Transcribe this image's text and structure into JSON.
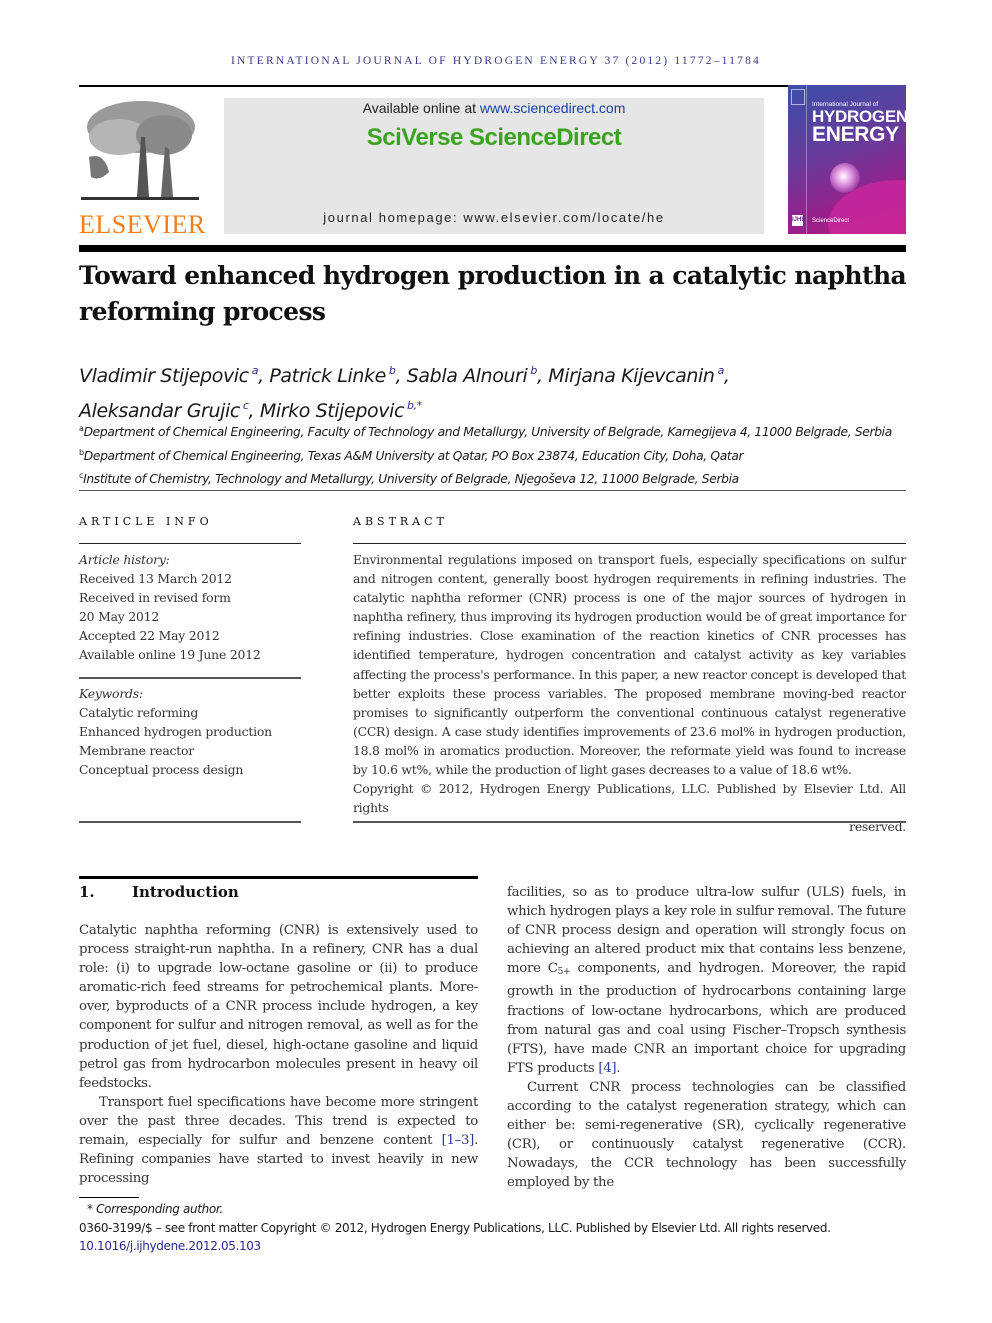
{
  "running_head": "INTERNATIONAL JOURNAL OF HYDROGEN ENERGY 37 (2012) 11772–11784",
  "masthead": {
    "publisher_logo_text": "ELSEVIER",
    "available_online_prefix": "Available online at ",
    "available_online_link": "www.sciencedirect.com",
    "brand": "SciVerse ScienceDirect",
    "homepage": "journal homepage: www.elsevier.com/locate/he",
    "cover": {
      "small_title": "International Journal of",
      "big_title_1": "HYDROGEN",
      "big_title_2": "ENERGY",
      "badge": "IJHE",
      "footer": "ScienceDirect"
    },
    "colors": {
      "elsevier_orange": "#f07f1a",
      "sciencedirect_green": "#3aa41e",
      "link_blue": "#1a3fa8",
      "running_head": "#3a3a86"
    }
  },
  "article": {
    "title": "Toward enhanced hydrogen production in a catalytic naphtha reforming process",
    "authors": [
      {
        "name": "Vladimir Stijepovic",
        "aff": "a",
        "sep": ", "
      },
      {
        "name": "Patrick Linke",
        "aff": "b",
        "sep": ", "
      },
      {
        "name": "Sabla Alnouri",
        "aff": "b",
        "sep": ", "
      },
      {
        "name": "Mirjana Kijevcanin",
        "aff": "a",
        "sep": ","
      },
      {
        "name": "Aleksandar Grujic",
        "aff": "c",
        "sep": ", "
      },
      {
        "name": "Mirko Stijepovic",
        "aff": "b,*",
        "sep": ""
      }
    ],
    "affiliations": [
      {
        "key": "a",
        "text": "Department of Chemical Engineering, Faculty of Technology and Metallurgy, University of Belgrade, Karnegijeva 4, 11000 Belgrade, Serbia"
      },
      {
        "key": "b",
        "text": "Department of Chemical Engineering, Texas A&M University at Qatar, PO Box 23874, Education City, Doha, Qatar"
      },
      {
        "key": "c",
        "text": "Institute of Chemistry, Technology and Metallurgy, University of Belgrade, Njegoševa 12, 11000 Belgrade, Serbia"
      }
    ]
  },
  "article_info": {
    "heading": "ARTICLE INFO",
    "history_label": "Article history:",
    "history": [
      "Received 13 March 2012",
      "Received in revised form",
      "20 May 2012",
      "Accepted 22 May 2012",
      "Available online 19 June 2012"
    ],
    "keywords_label": "Keywords:",
    "keywords": [
      "Catalytic reforming",
      "Enhanced hydrogen production",
      "Membrane reactor",
      "Conceptual process design"
    ]
  },
  "abstract": {
    "heading": "ABSTRACT",
    "body": "Environmental regulations imposed on transport fuels, especially specifications on sulfur and nitrogen content, generally boost hydrogen requirements in refining industries. The catalytic naphtha reformer (CNR) process is one of the major sources of hydrogen in naphtha refinery, thus improving its hydrogen production would be of great importance for refining industries. Close examination of the reaction kinetics of CNR processes has identified temperature, hydrogen concentration and catalyst activity as key variables affecting the process's performance. In this paper, a new reactor concept is developed that better exploits these process variables. The proposed membrane moving-bed reactor promises to significantly outperform the conventional continuous catalyst regenerative (CCR) design. A case study identifies improvements of 23.6 mol% in hydrogen production, 18.8 mol% in aromatics production. Moreover, the reformate yield was found to increase by 10.6 wt%, while the production of light gases decreases to a value of 18.6 wt%.",
    "copyright": "Copyright © 2012, Hydrogen Energy Publications, LLC. Published by Elsevier Ltd. All rights",
    "copyright_end": "reserved."
  },
  "introduction": {
    "number": "1.",
    "heading": "Introduction",
    "p1": "Catalytic naphtha reforming (CNR) is extensively used to process straight-run naphtha. In a refinery, CNR has a dual role: (i) to upgrade low-octane gasoline or (ii) to produce aromatic-rich feed streams for petrochemical plants. More-over, byproducts of a CNR process include hydrogen, a key component for sulfur and nitrogen removal, as well as for the production of jet fuel, diesel, high-octane gasoline and liquid petrol gas from hydrocarbon molecules present in heavy oil feedstocks.",
    "p2_a": "Transport fuel specifications have become more stringent over the past three decades. This trend is expected to remain, especially for sulfur and benzene content ",
    "p2_ref": "[1–3]",
    "p2_b": ". Refining companies have started to invest heavily in new processing",
    "r1_a": "facilities, so as to produce ultra-low sulfur (ULS) fuels, in which hydrogen plays a key role in sulfur removal. The future of CNR process design and operation will strongly focus on achieving an altered product mix that contains less benzene, more C",
    "r1_sub": "5+",
    "r1_b": " components, and hydrogen. Moreover, the rapid growth in the production of hydrocarbons containing large fractions of low-octane hydrocarbons, which are produced from natural gas and coal using Fischer–Tropsch synthesis (FTS), have made CNR an important choice for upgrading FTS products ",
    "r1_ref": "[4]",
    "r1_c": ".",
    "r2": "Current CNR process technologies can be classified according to the catalyst regeneration strategy, which can either be: semi-regenerative (SR), cyclically regenerative (CR), or continuously catalyst regenerative (CCR). Nowadays, the CCR technology has been successfully employed by the"
  },
  "footnotes": {
    "corresponding": "* Corresponding author.",
    "front_matter": "0360-3199/$ – see front matter Copyright © 2012, Hydrogen Energy Publications, LLC. Published by Elsevier Ltd. All rights reserved.",
    "doi": "10.1016/j.ijhydene.2012.05.103"
  }
}
